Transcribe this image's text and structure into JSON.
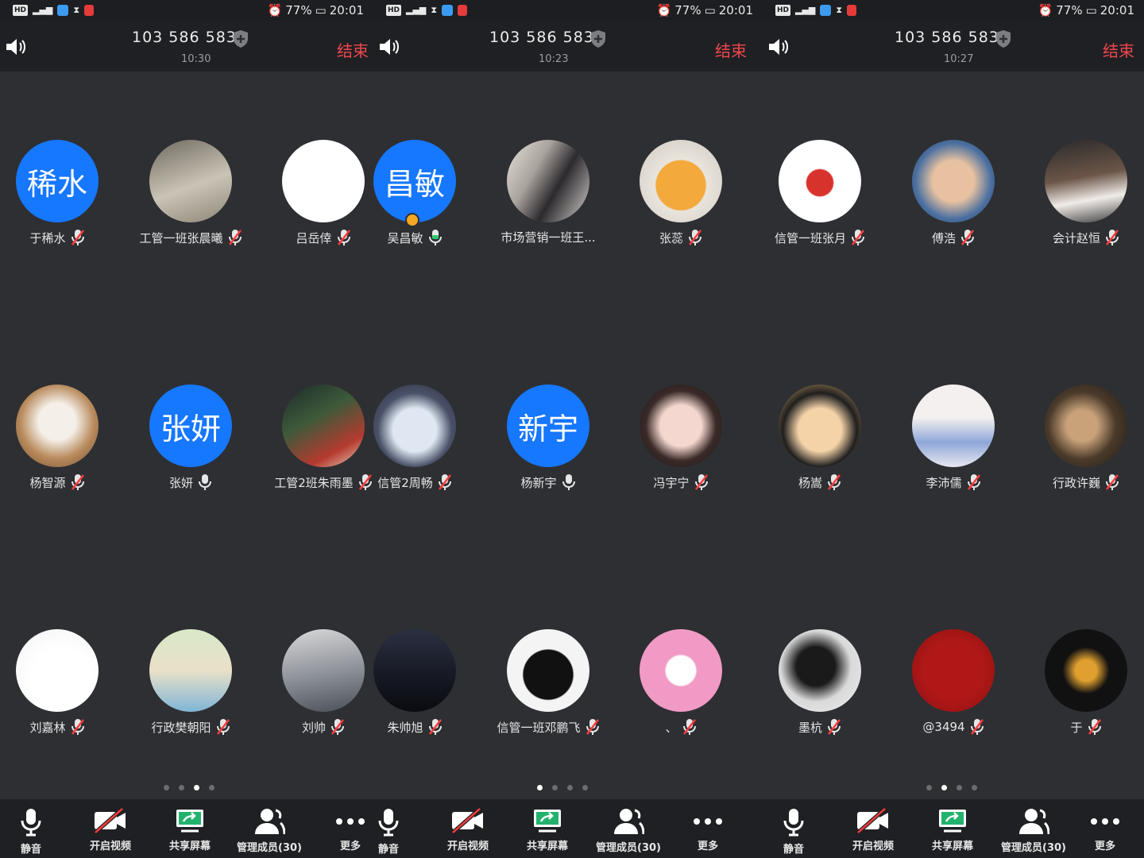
{
  "screens": [
    {
      "status": {
        "battery": "77%",
        "time": "20:01"
      },
      "header": {
        "meeting_id": "103 586 583",
        "time": "10:30",
        "end_label": "结束"
      },
      "participants": [
        {
          "name": "于稀水",
          "avatar_text": "稀水",
          "avatar": "text",
          "mic": "muted"
        },
        {
          "name": "工管一班张晨曦",
          "avatar": "image",
          "avatar_desc": "astronaut-photo",
          "mic": "muted"
        },
        {
          "name": "吕岳倖",
          "avatar": "white",
          "mic": "muted"
        },
        {
          "name": "杨智源",
          "avatar": "image",
          "avatar_desc": "puppy-photo",
          "mic": "muted"
        },
        {
          "name": "张妍",
          "avatar_text": "张妍",
          "avatar": "text",
          "mic": "on"
        },
        {
          "name": "工管2班朱雨墨",
          "avatar": "image",
          "avatar_desc": "anime-girl-photo",
          "mic": "muted"
        },
        {
          "name": "刘嘉林",
          "avatar": "image",
          "avatar_desc": "cartoon-ghost",
          "mic": "muted"
        },
        {
          "name": "行政樊朝阳",
          "avatar": "image",
          "avatar_desc": "cartoon-boy",
          "mic": "muted"
        },
        {
          "name": "刘帅",
          "avatar": "image",
          "avatar_desc": "ink-painting",
          "mic": "muted"
        }
      ],
      "page_dots": {
        "count": 4,
        "active": 2
      },
      "toolbar": [
        "静音",
        "开启视频",
        "共享屏幕",
        "管理成员(30)",
        "更多"
      ]
    },
    {
      "status": {
        "battery": "77%",
        "time": "20:01"
      },
      "header": {
        "meeting_id": "103 586 583",
        "time": "10:23",
        "end_label": "结束"
      },
      "participants": [
        {
          "name": "吴昌敏",
          "avatar_text": "昌敏",
          "avatar": "text",
          "mic": "on",
          "host": true
        },
        {
          "name": "市场营销一班王...",
          "avatar": "image",
          "avatar_desc": "anime-boy",
          "mic": "muted"
        },
        {
          "name": "张蕊",
          "avatar": "image",
          "avatar_desc": "cartoon-bear",
          "mic": "muted"
        },
        {
          "name": "信管2周畅",
          "avatar": "image",
          "avatar_desc": "anime-catgirl",
          "mic": "muted"
        },
        {
          "name": "杨新宇",
          "avatar_text": "新宇",
          "avatar": "text",
          "mic": "on"
        },
        {
          "name": "冯宇宁",
          "avatar": "image",
          "avatar_desc": "girl-photo",
          "mic": "muted"
        },
        {
          "name": "朱帅旭",
          "avatar": "image",
          "avatar_desc": "night-sky",
          "mic": "muted"
        },
        {
          "name": "信管一班邓鹏飞",
          "avatar": "image",
          "avatar_desc": "helmet-rider",
          "mic": "muted"
        },
        {
          "name": "、",
          "avatar": "image",
          "avatar_desc": "cartoon-girl",
          "mic": "muted"
        }
      ],
      "page_dots": {
        "count": 4,
        "active": 0
      },
      "toolbar": [
        "静音",
        "开启视频",
        "共享屏幕",
        "管理成员(30)",
        "更多"
      ]
    },
    {
      "status": {
        "battery": "77%",
        "time": "20:01"
      },
      "header": {
        "meeting_id": "103 586 583",
        "time": "10:27",
        "end_label": "结束"
      },
      "participants": [
        {
          "name": "信管一班张月",
          "avatar": "image",
          "avatar_desc": "lucky-bag",
          "mic": "muted"
        },
        {
          "name": "傅浩",
          "avatar": "image",
          "avatar_desc": "actor-photo",
          "mic": "muted"
        },
        {
          "name": "会计赵恒",
          "avatar": "image",
          "avatar_desc": "family-photo",
          "mic": "muted"
        },
        {
          "name": "杨嵩",
          "avatar": "image",
          "avatar_desc": "anime-pirate",
          "mic": "muted"
        },
        {
          "name": "李沛儒",
          "avatar": "image",
          "avatar_desc": "child-photo",
          "mic": "muted"
        },
        {
          "name": "行政许巍",
          "avatar": "image",
          "avatar_desc": "wizard-girl",
          "mic": "muted"
        },
        {
          "name": "墨杭",
          "avatar": "image",
          "avatar_desc": "man-photo",
          "mic": "muted"
        },
        {
          "name": "@3494",
          "avatar": "image",
          "avatar_desc": "red-calligraphy",
          "mic": "muted"
        },
        {
          "name": "于",
          "avatar": "image",
          "avatar_desc": "gold-calligraphy",
          "mic": "muted"
        }
      ],
      "page_dots": {
        "count": 4,
        "active": 1
      },
      "toolbar": [
        "静音",
        "开启视频",
        "共享屏幕",
        "管理成员(30)",
        "更多"
      ]
    }
  ],
  "colors": {
    "accent": "#1677ff",
    "end": "#f0464e",
    "muted_mic": "#ff3b3b",
    "active_mic": "#2ecc71",
    "background": "#2e2f33"
  }
}
